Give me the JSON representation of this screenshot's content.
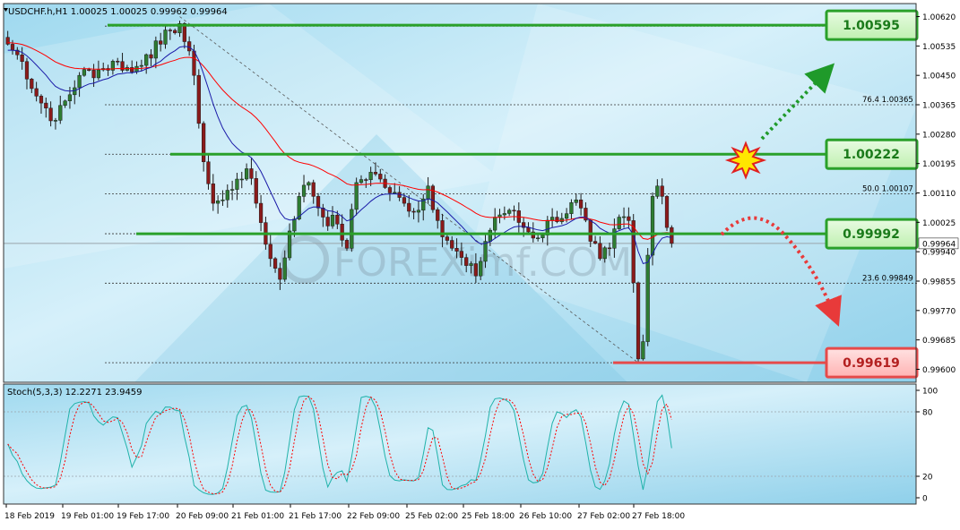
{
  "chart_data": {
    "type": "candlestick",
    "symbol_header": "USDCHF.h,H1  1.00025 1.00025 0.99962 0.99964",
    "price_axis": {
      "ylim": [
        0.99565,
        1.00655
      ],
      "ticks": [
        "1.00620",
        "1.00535",
        "1.00450",
        "1.00365",
        "1.00280",
        "1.00195",
        "1.00110",
        "1.00025",
        "0.99940",
        "0.99855",
        "0.99770",
        "0.99685",
        "0.99600"
      ],
      "current_price_label": "0.99964"
    },
    "time_axis_labels": [
      "18 Feb 2019",
      "19 Feb 01:00",
      "19 Feb 17:00",
      "20 Feb 09:00",
      "21 Feb 01:00",
      "21 Feb 17:00",
      "22 Feb 09:00",
      "25 Feb 02:00",
      "25 Feb 18:00",
      "26 Feb 10:00",
      "27 Feb 02:00",
      "27 Feb 18:00"
    ],
    "candles": {
      "count": 140,
      "close_anchors": [
        [
          0,
          1.0054
        ],
        [
          3,
          1.0049
        ],
        [
          6,
          1.0039
        ],
        [
          10,
          1.0032
        ],
        [
          15,
          1.0045
        ],
        [
          20,
          1.0047
        ],
        [
          23,
          1.0049
        ],
        [
          26,
          1.0046
        ],
        [
          29,
          1.0051
        ],
        [
          32,
          1.0054
        ],
        [
          34,
          1.0058
        ],
        [
          36,
          1.006
        ],
        [
          39,
          1.0045
        ],
        [
          41,
          1.002
        ],
        [
          43,
          1.0008
        ],
        [
          45,
          1.0009
        ],
        [
          48,
          1.0015
        ],
        [
          50,
          1.0018
        ],
        [
          52,
          1.0008
        ],
        [
          55,
          0.9992
        ],
        [
          57,
          0.9986
        ],
        [
          59,
          1.0
        ],
        [
          61,
          1.001
        ],
        [
          63,
          1.0014
        ],
        [
          66,
          1.0004
        ],
        [
          69,
          1.0002
        ],
        [
          71,
          0.9995
        ],
        [
          73,
          1.0014
        ],
        [
          76,
          1.0017
        ],
        [
          78,
          1.0015
        ],
        [
          80,
          1.0011
        ],
        [
          83,
          1.0008
        ],
        [
          86,
          1.0006
        ],
        [
          88,
          1.0013
        ],
        [
          90,
          1.0003
        ],
        [
          93,
          0.9995
        ],
        [
          96,
          0.999
        ],
        [
          98,
          0.9987
        ],
        [
          100,
          0.9997
        ],
        [
          102,
          1.0004
        ],
        [
          105,
          1.0006
        ],
        [
          108,
          1.0001
        ],
        [
          111,
          0.9998
        ],
        [
          114,
          1.0004
        ],
        [
          117,
          1.0005
        ],
        [
          119,
          1.0009
        ],
        [
          122,
          0.9997
        ],
        [
          124,
          0.9992
        ],
        [
          126,
          0.9995
        ],
        [
          128,
          1.0004
        ],
        [
          130,
          1.0003
        ],
        [
          131,
          0.9985
        ],
        [
          132,
          0.9963
        ],
        [
          133,
          0.9968
        ],
        [
          134,
          0.9993
        ],
        [
          135,
          1.001
        ],
        [
          136,
          1.0013
        ],
        [
          137,
          1.001
        ],
        [
          138,
          1.0001
        ],
        [
          139,
          0.99964
        ]
      ]
    },
    "moving_averages": [
      {
        "name": "MA slow",
        "color": "#ff0000"
      },
      {
        "name": "MA fast",
        "color": "#1a1aa8"
      }
    ],
    "levels": [
      {
        "label": "1.00595",
        "price": 1.00595,
        "kind": "resistance"
      },
      {
        "label": "1.00222",
        "price": 1.00222,
        "kind": "resistance"
      },
      {
        "label": "0.99992",
        "price": 0.99992,
        "kind": "support"
      },
      {
        "label": "0.99619",
        "price": 0.99619,
        "kind": "support"
      }
    ],
    "fibonacci": [
      {
        "label": "76.4  1.00365",
        "price": 1.00365
      },
      {
        "label": "50.0  1.00107",
        "price": 1.00107
      },
      {
        "label": "23.6  0.99849",
        "price": 0.99849
      }
    ],
    "stochastic": {
      "header": "Stoch(5,3,3) 12.2271 23.9459",
      "ylim": [
        0,
        100
      ],
      "ticks": [
        "100",
        "80",
        "20",
        "0"
      ],
      "main_color": "#20b2aa",
      "signal_color": "#ff0000"
    },
    "watermark": "FOREXimf.COM"
  }
}
